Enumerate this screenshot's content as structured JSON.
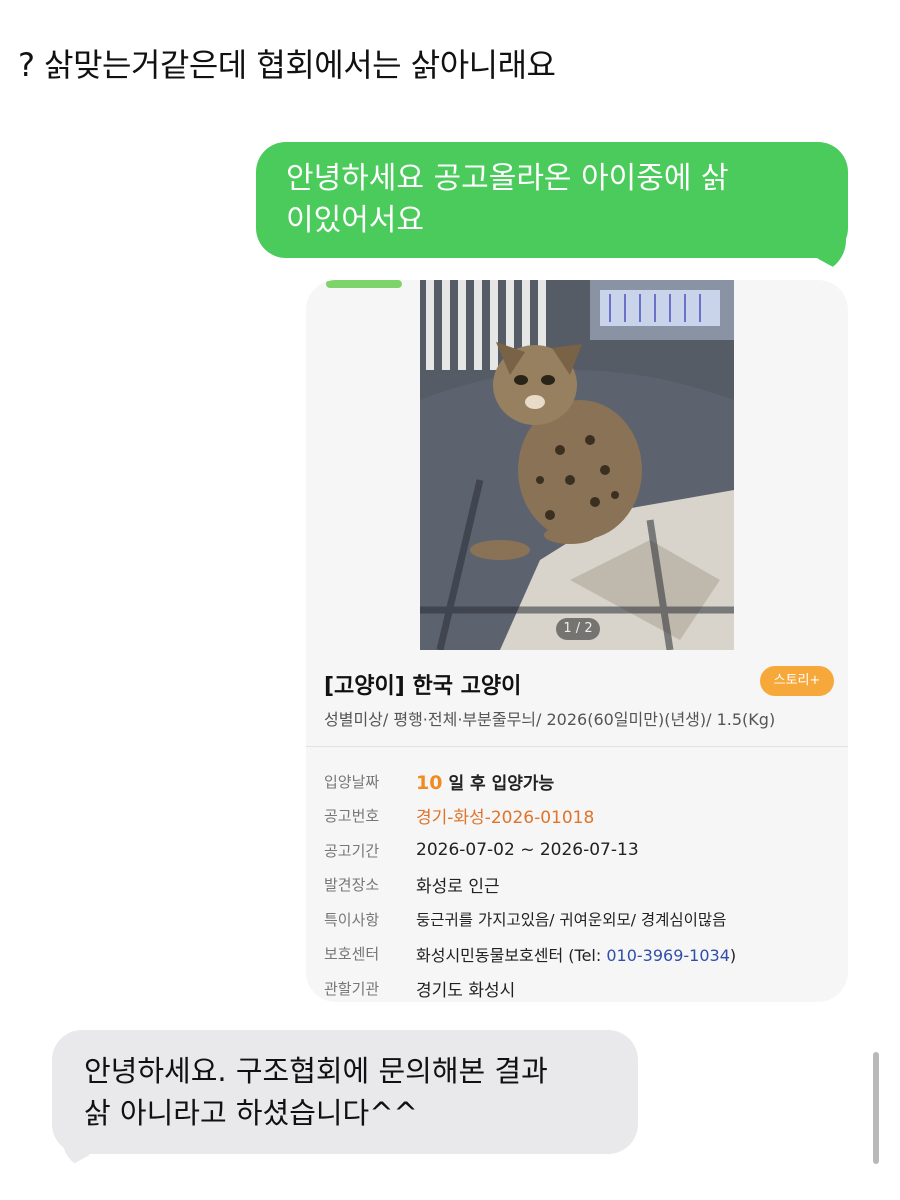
{
  "caption": "? 삵맞는거같은데 협회에서는 삵아니래요",
  "messages": {
    "sent_line1": "안녕하세요 공고올라온 아이중에 삵",
    "sent_line2": "이있어서요",
    "received_line1": "안녕하세요. 구조협회에 문의해본 결과",
    "received_line2": "삵 아니라고 하셨습니다^^"
  },
  "card": {
    "photo_counter": "1 / 2",
    "title": "[고양이] 한국 고양이",
    "badge": "스토리+",
    "subtitle": "성별미상/ 평행·전체·부분줄무늬/ 2026(60일미만)(년생)/ 1.5(Kg)",
    "rows": [
      {
        "label": "입양날짜",
        "value_num": "10",
        "value": "일 후 입양가능"
      },
      {
        "label": "공고번호",
        "value": "경기-화성-2026-01018"
      },
      {
        "label": "공고기간",
        "value": "2026-07-02 ~ 2026-07-13"
      },
      {
        "label": "발견장소",
        "value": "화성로 인근"
      },
      {
        "label": "특이사항",
        "value": "둥근귀를 가지고있음/ 귀여운외모/ 경계심이많음"
      },
      {
        "label": "보호센터",
        "value": "화성시민동물보호센터 (Tel: ",
        "tel": "010-3969-1034",
        "value_end": ")"
      },
      {
        "label": "관할기관",
        "value": "경기도 화성시"
      }
    ]
  },
  "colors": {
    "sent_bubble": "#4bcb5b",
    "received_bubble": "#e9e9eb",
    "badge": "#f7a83a",
    "accent_orange": "#e0742a",
    "tel_blue": "#2f4ea8"
  },
  "icons": [
    "kitten-photo"
  ]
}
